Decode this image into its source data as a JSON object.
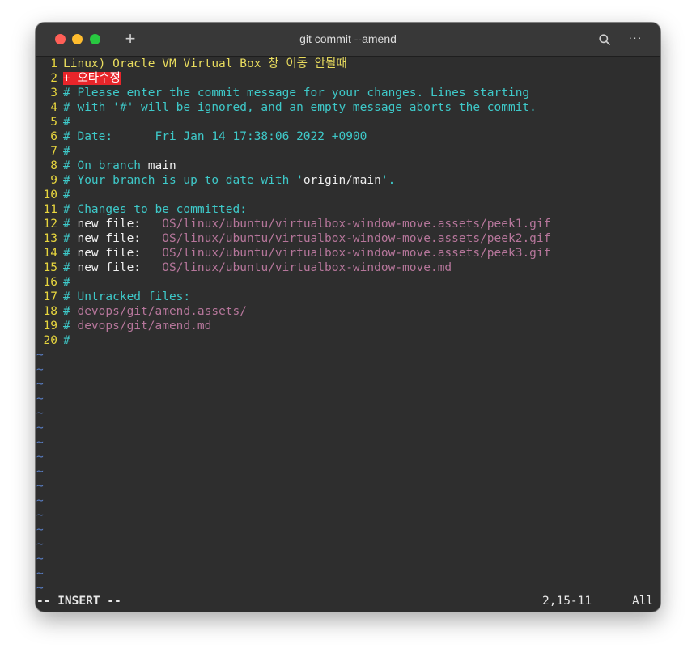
{
  "window": {
    "title": "git commit --amend",
    "new_tab_label": "+",
    "more_label": "···"
  },
  "editor": {
    "lines": [
      {
        "n": "1",
        "segs": [
          {
            "t": "Linux) Oracle VM Virtual Box 창 이동 안될때",
            "c": "c-title"
          }
        ]
      },
      {
        "n": "2",
        "segs": [
          {
            "t": "+ 오타수정",
            "c": "c-highlight"
          }
        ],
        "cursor": true
      },
      {
        "n": "3",
        "segs": [
          {
            "t": "# Please enter the commit message for your changes. Lines starting",
            "c": "c-comment"
          }
        ]
      },
      {
        "n": "4",
        "segs": [
          {
            "t": "# with '#' will be ignored, and an empty message aborts the commit.",
            "c": "c-comment"
          }
        ]
      },
      {
        "n": "5",
        "segs": [
          {
            "t": "#",
            "c": "c-comment"
          }
        ]
      },
      {
        "n": "6",
        "segs": [
          {
            "t": "# Date:      Fri Jan 14 17:38:06 2022 +0900",
            "c": "c-comment"
          }
        ]
      },
      {
        "n": "7",
        "segs": [
          {
            "t": "#",
            "c": "c-comment"
          }
        ]
      },
      {
        "n": "8",
        "segs": [
          {
            "t": "# On branch ",
            "c": "c-comment"
          },
          {
            "t": "main",
            "c": "c-white"
          }
        ]
      },
      {
        "n": "9",
        "segs": [
          {
            "t": "# Your branch is up to date with '",
            "c": "c-comment"
          },
          {
            "t": "origin/main",
            "c": "c-white"
          },
          {
            "t": "'.",
            "c": "c-comment"
          }
        ]
      },
      {
        "n": "10",
        "segs": [
          {
            "t": "#",
            "c": "c-comment"
          }
        ]
      },
      {
        "n": "11",
        "segs": [
          {
            "t": "# Changes to be committed:",
            "c": "c-comment"
          }
        ]
      },
      {
        "n": "12",
        "segs": [
          {
            "t": "# ",
            "c": "c-comment"
          },
          {
            "t": "new file:   ",
            "c": "c-white"
          },
          {
            "t": "OS/linux/ubuntu/virtualbox-window-move.assets/peek1.gif",
            "c": "c-pink"
          }
        ]
      },
      {
        "n": "13",
        "segs": [
          {
            "t": "# ",
            "c": "c-comment"
          },
          {
            "t": "new file:   ",
            "c": "c-white"
          },
          {
            "t": "OS/linux/ubuntu/virtualbox-window-move.assets/peek2.gif",
            "c": "c-pink"
          }
        ]
      },
      {
        "n": "14",
        "segs": [
          {
            "t": "# ",
            "c": "c-comment"
          },
          {
            "t": "new file:   ",
            "c": "c-white"
          },
          {
            "t": "OS/linux/ubuntu/virtualbox-window-move.assets/peek3.gif",
            "c": "c-pink"
          }
        ]
      },
      {
        "n": "15",
        "segs": [
          {
            "t": "# ",
            "c": "c-comment"
          },
          {
            "t": "new file:   ",
            "c": "c-white"
          },
          {
            "t": "OS/linux/ubuntu/virtualbox-window-move.md",
            "c": "c-pink"
          }
        ]
      },
      {
        "n": "16",
        "segs": [
          {
            "t": "#",
            "c": "c-comment"
          }
        ]
      },
      {
        "n": "17",
        "segs": [
          {
            "t": "# Untracked files:",
            "c": "c-comment"
          }
        ]
      },
      {
        "n": "18",
        "segs": [
          {
            "t": "# ",
            "c": "c-comment"
          },
          {
            "t": "devops/git/amend.assets/",
            "c": "c-pink"
          }
        ]
      },
      {
        "n": "19",
        "segs": [
          {
            "t": "# ",
            "c": "c-comment"
          },
          {
            "t": "devops/git/amend.md",
            "c": "c-pink"
          }
        ]
      },
      {
        "n": "20",
        "segs": [
          {
            "t": "#",
            "c": "c-comment"
          }
        ]
      }
    ],
    "empty_line_marker": "~",
    "empty_line_count": 17
  },
  "status": {
    "mode": "-- INSERT --",
    "position": "2,15-11",
    "scroll": "All"
  },
  "colors": {
    "background": "#2e2e2e",
    "line_number": "#e7d53e",
    "comment": "#3ec9c9",
    "path": "#b6769b",
    "highlight": "#e8252a",
    "tilde": "#5a7fc6"
  }
}
